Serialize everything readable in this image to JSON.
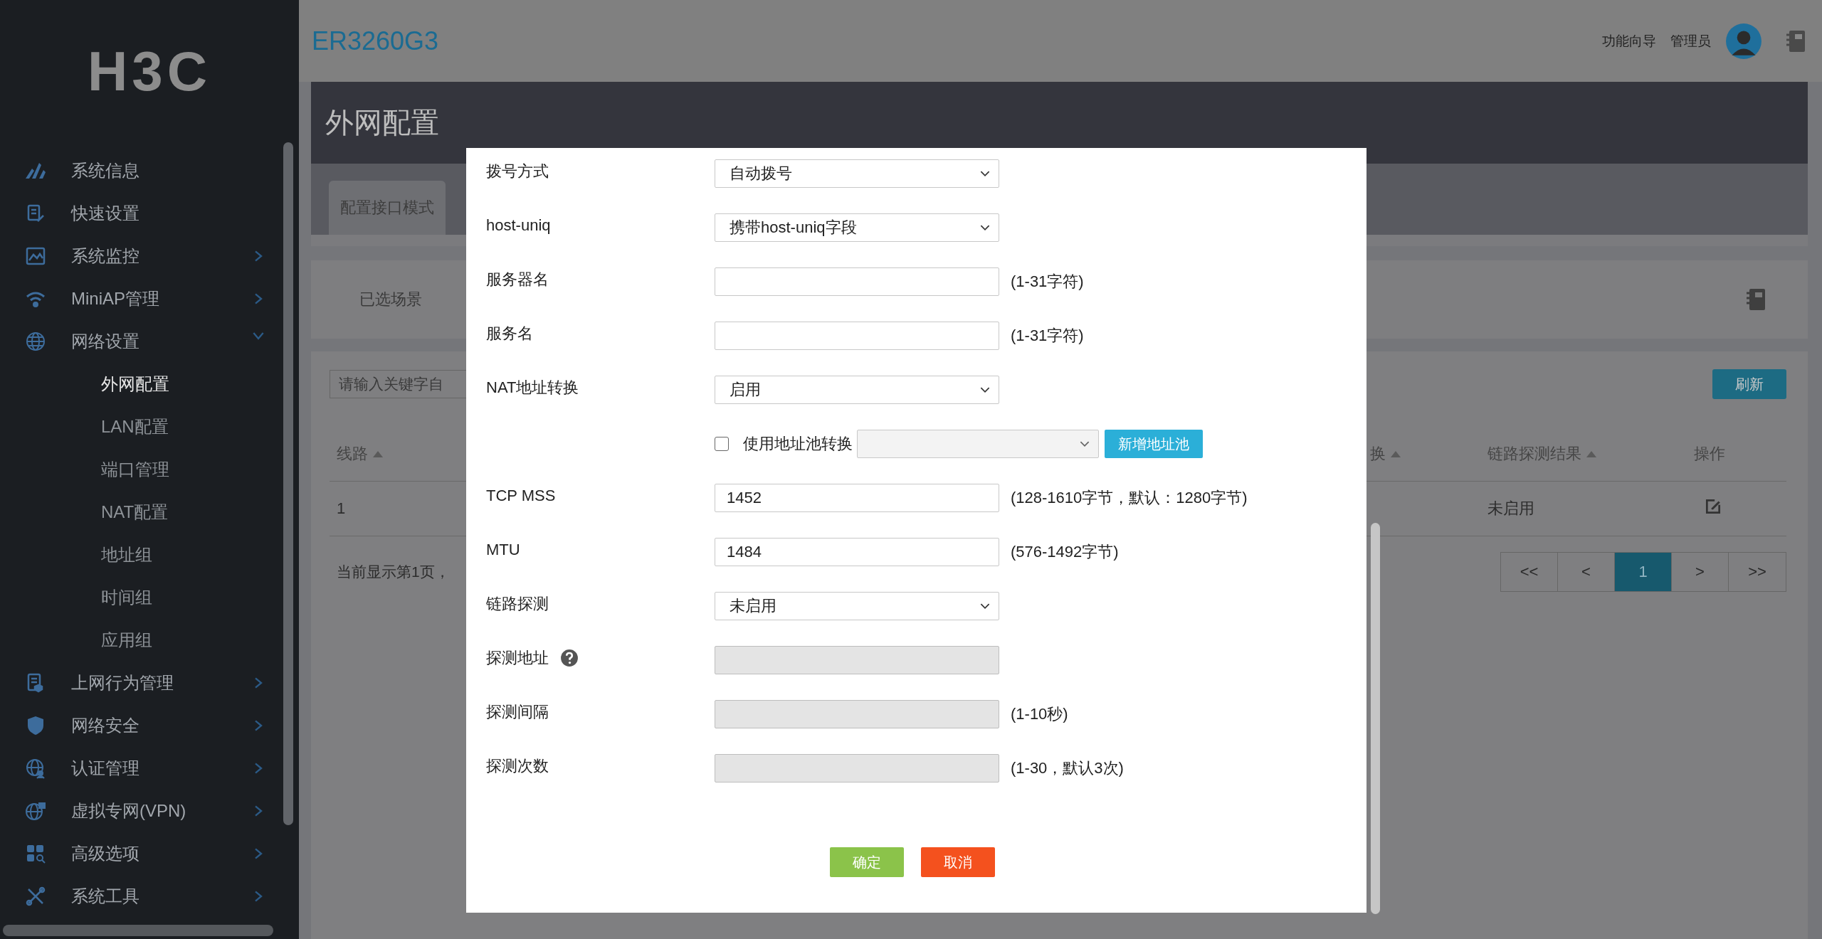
{
  "sidebar": {
    "logo": "H3C",
    "items": [
      {
        "label": "系统信息",
        "kind": "link"
      },
      {
        "label": "快速设置",
        "kind": "link"
      },
      {
        "label": "系统监控",
        "kind": "group",
        "expanded": false
      },
      {
        "label": "MiniAP管理",
        "kind": "group",
        "expanded": false
      },
      {
        "label": "网络设置",
        "kind": "group",
        "expanded": true,
        "children": [
          {
            "label": "外网配置",
            "selected": true
          },
          {
            "label": "LAN配置",
            "selected": false
          },
          {
            "label": "端口管理",
            "selected": false
          },
          {
            "label": "NAT配置",
            "selected": false
          },
          {
            "label": "地址组",
            "selected": false
          },
          {
            "label": "时间组",
            "selected": false
          },
          {
            "label": "应用组",
            "selected": false
          }
        ]
      },
      {
        "label": "上网行为管理",
        "kind": "group",
        "expanded": false
      },
      {
        "label": "网络安全",
        "kind": "group",
        "expanded": false
      },
      {
        "label": "认证管理",
        "kind": "group",
        "expanded": false
      },
      {
        "label": "虚拟专网(VPN)",
        "kind": "group",
        "expanded": false
      },
      {
        "label": "高级选项",
        "kind": "group",
        "expanded": false
      },
      {
        "label": "系统工具",
        "kind": "group",
        "expanded": false
      }
    ]
  },
  "header": {
    "title": "ER3260G3",
    "links": [
      "功能向导",
      "管理员"
    ]
  },
  "page": {
    "title": "外网配置",
    "tabs": [
      {
        "label": "配置接口模式",
        "selected": true
      }
    ],
    "scene_label": "已选场景",
    "search": {
      "placeholder": "请输入关键字自"
    },
    "refresh_button": "刷新",
    "table": {
      "columns": [
        {
          "label": "线路",
          "sortable": true
        },
        {
          "label": "换",
          "sortable": true
        },
        {
          "label": "链路探测结果",
          "sortable": true
        },
        {
          "label": "操作",
          "sortable": false
        }
      ],
      "rows": [
        {
          "cells": [
            "1",
            "",
            "未启用"
          ]
        }
      ]
    },
    "footer": "当前显示第1页，",
    "pagination": [
      {
        "label": "<<",
        "selected": false
      },
      {
        "label": "<",
        "selected": false
      },
      {
        "label": "1",
        "selected": true
      },
      {
        "label": ">",
        "selected": false
      },
      {
        "label": ">>",
        "selected": false
      }
    ]
  },
  "dialog": {
    "rows": [
      {
        "kind": "select",
        "label": "拨号方式",
        "value": "自动拨号",
        "disabled": false,
        "help": false
      },
      {
        "kind": "select",
        "label": "host-uniq",
        "value": "携带host-uniq字段",
        "disabled": false,
        "help": false
      },
      {
        "kind": "input",
        "label": "服务器名",
        "hint": "(1-31字符)",
        "disabled": false,
        "help": false
      },
      {
        "kind": "input",
        "label": "服务名",
        "hint": "(1-31字符)",
        "disabled": false,
        "help": false
      },
      {
        "kind": "select",
        "label": "NAT地址转换",
        "value": "启用",
        "disabled": false,
        "help": false
      },
      {
        "kind": "pool",
        "checkbox_label": "使用地址池转换",
        "checked": false,
        "disabled": true,
        "button": "新增地址池"
      },
      {
        "kind": "input",
        "label": "TCP MSS",
        "value": "1452",
        "hint": "(128-1610字节，默认：1280字节)",
        "disabled": false,
        "help": false
      },
      {
        "kind": "input",
        "label": "MTU",
        "value": "1484",
        "hint": "(576-1492字节)",
        "disabled": false,
        "help": false
      },
      {
        "kind": "select",
        "label": "链路探测",
        "value": "未启用",
        "disabled": false,
        "help": false
      },
      {
        "kind": "input",
        "label": "探测地址",
        "disabled": true,
        "help": true
      },
      {
        "kind": "input",
        "label": "探测间隔",
        "hint": "(1-10秒)",
        "disabled": true,
        "help": false
      },
      {
        "kind": "input",
        "label": "探测次数",
        "hint": "(1-30，默认3次)",
        "disabled": true,
        "help": false
      }
    ],
    "buttons": [
      {
        "label": "确定",
        "kind": "confirm"
      },
      {
        "label": "取消",
        "kind": "cancel"
      }
    ]
  }
}
